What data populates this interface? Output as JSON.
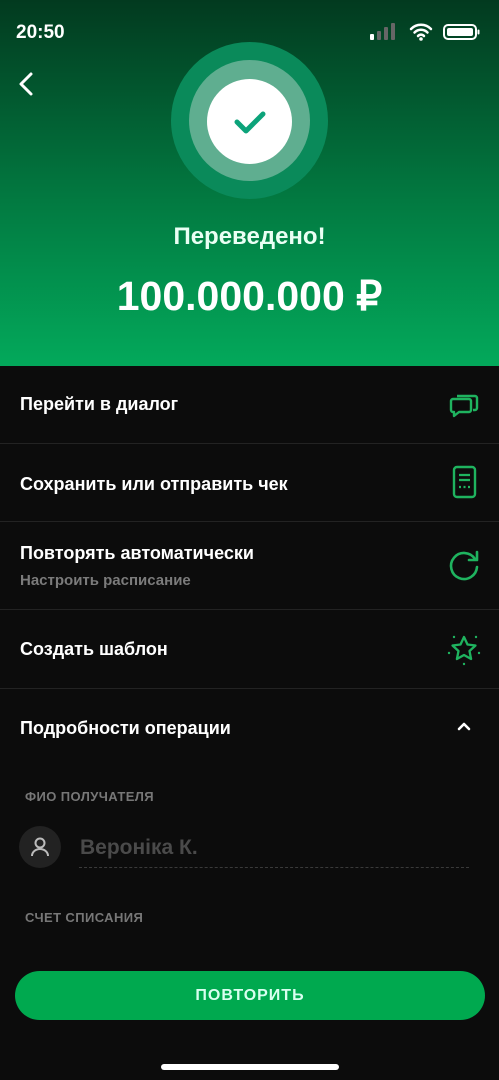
{
  "status_bar": {
    "time": "20:50",
    "icons": [
      "signal-icon",
      "wifi-icon",
      "battery-icon"
    ]
  },
  "header": {
    "title": "Переведено!",
    "amount": "100.000.000 ₽",
    "accent": "#00a94f"
  },
  "actions": [
    {
      "label": "Перейти в диалог",
      "icon": "chat-icon"
    },
    {
      "label": "Сохранить или отправить чек",
      "icon": "receipt-icon"
    },
    {
      "label": "Повторять автоматически",
      "sublabel": "Настроить расписание",
      "icon": "repeat-icon"
    },
    {
      "label": "Создать шаблон",
      "icon": "star-icon"
    }
  ],
  "details": {
    "title": "Подробности операции",
    "recipient_caption": "ФИО ПОЛУЧАТЕЛЯ",
    "recipient_name": "Вероніка К.",
    "account_caption": "СЧЕТ СПИСАНИЯ"
  },
  "repeat_button": "ПОВТОРИТЬ"
}
